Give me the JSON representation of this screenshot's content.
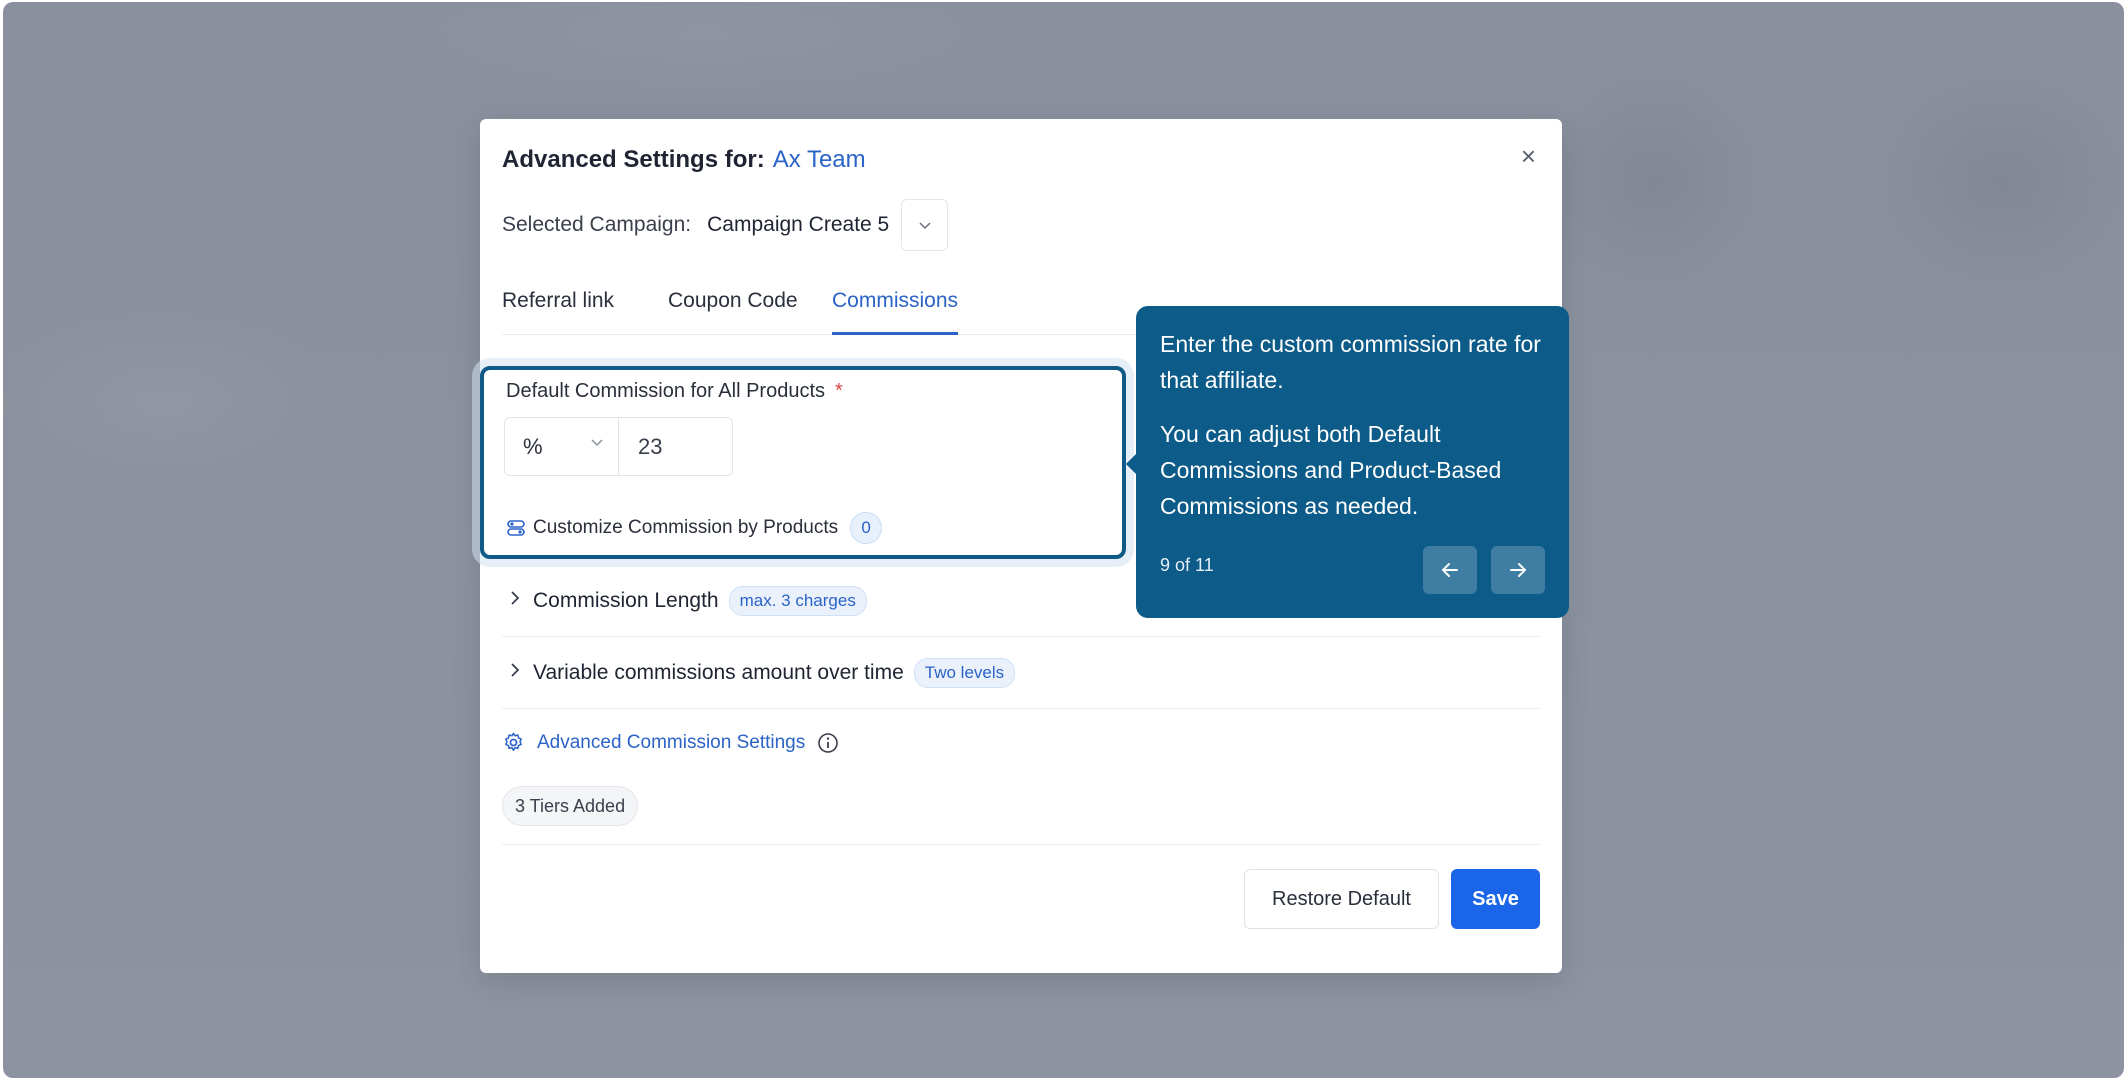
{
  "modal": {
    "title_prefix": "Advanced Settings for:",
    "team_name": "Ax Team",
    "close_glyph": "×"
  },
  "campaign": {
    "label": "Selected Campaign:",
    "value": "Campaign Create 5"
  },
  "tabs": [
    {
      "label": "Referral link",
      "active": false
    },
    {
      "label": "Coupon Code",
      "active": false
    },
    {
      "label": "Commissions",
      "active": true
    }
  ],
  "default_commission": {
    "label": "Default Commission for All Products",
    "required_marker": "*",
    "unit": "%",
    "value": "23",
    "customize_label": "Customize Commission by Products",
    "customize_count": "0"
  },
  "accordions": [
    {
      "label": "Commission Length",
      "badge": "max. 3 charges"
    },
    {
      "label": "Variable commissions amount over time",
      "badge": "Two levels"
    }
  ],
  "advanced": {
    "label": "Advanced Commission Settings",
    "tiers_badge": "3 Tiers Added"
  },
  "footer": {
    "restore_label": "Restore Default",
    "save_label": "Save"
  },
  "tooltip": {
    "line1": "Enter the custom commission rate for that affiliate.",
    "line2": "You can adjust both Default Commissions and Product-Based Commissions as needed.",
    "step": "9 of 11"
  },
  "colors": {
    "accent": "#2b63c7",
    "primary_button": "#1b66e8",
    "tooltip_bg": "#0d5b88",
    "required": "#e04545"
  },
  "icons": [
    "close-icon",
    "chevron-down-icon",
    "toggle-icon",
    "chevron-right-icon",
    "gear-icon",
    "info-icon",
    "arrow-left-icon",
    "arrow-right-icon"
  ]
}
